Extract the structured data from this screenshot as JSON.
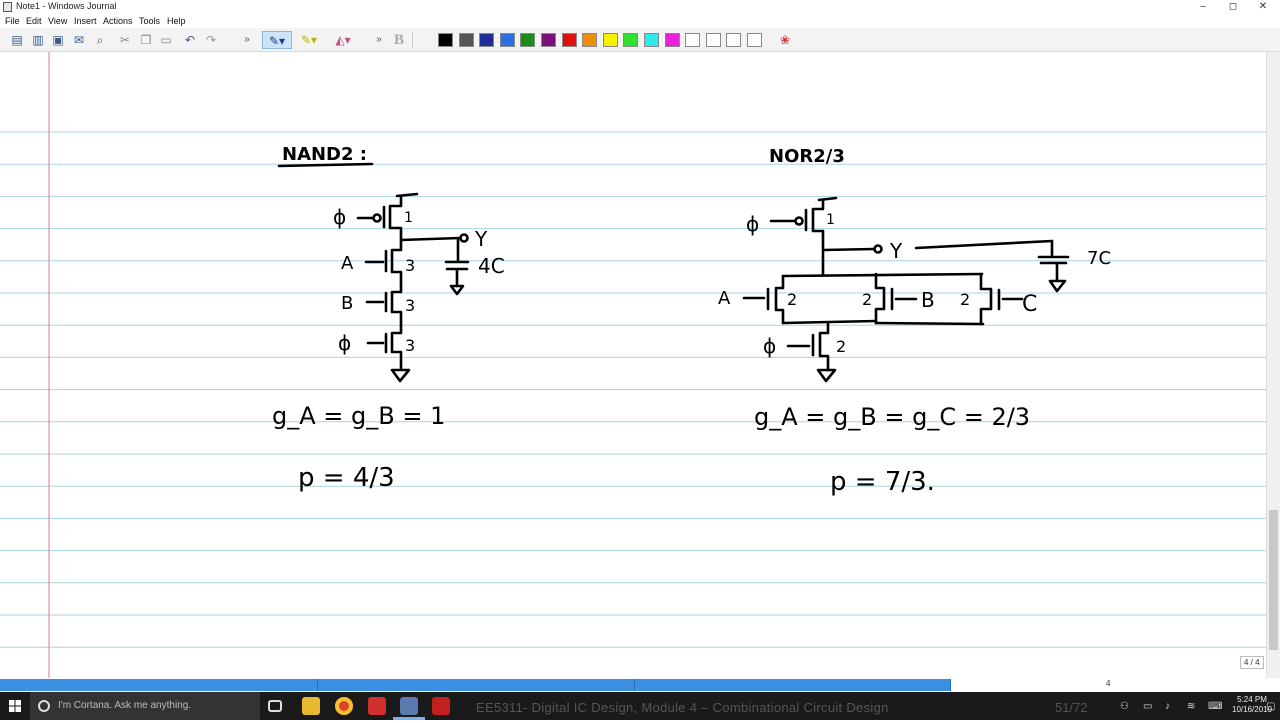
{
  "window": {
    "title": "Note1 - Windows Journal",
    "minimize": "–",
    "maximize": "◻",
    "close": "✕"
  },
  "menu": [
    "File",
    "Edit",
    "View",
    "Insert",
    "Actions",
    "Tools",
    "Help"
  ],
  "toolbar": {
    "bold_label": "B",
    "overflow": "»",
    "icons": [
      "new-note-icon",
      "open-icon",
      "save-icon",
      "email-icon",
      "find-icon",
      "cut-icon",
      "copy-icon",
      "paste-icon",
      "undo-icon",
      "redo-icon",
      "pen-icon",
      "highlighter-icon",
      "eraser-icon",
      "bold-icon",
      "color-wheel-icon"
    ],
    "colors": [
      "#000000",
      "#555555",
      "#1f2d9a",
      "#2b6ee0",
      "#1a8a1a",
      "#7a1080",
      "#e01010",
      "#f0900a",
      "#f5f000",
      "#30e030",
      "#30e8e8",
      "#e820d8",
      "#ffffff",
      "#ffffff",
      "#ffffff",
      "#ffffff"
    ]
  },
  "page": {
    "ruled_line_color": "#a8d4e6",
    "margin_line_color": "#e07a8a",
    "ink_color": "#000000"
  },
  "ink": {
    "left": {
      "title": "NAND2 :",
      "sizes": [
        "1",
        "3",
        "3",
        "3"
      ],
      "inputs": [
        "ϕ",
        "A",
        "B",
        "ϕ"
      ],
      "output": "Y",
      "load": "4C",
      "effort": "g_A = g_B = 1",
      "parasitic": "p = 4/3"
    },
    "right": {
      "title": "NOR2/3",
      "sizes": [
        "1",
        "2",
        "2",
        "2",
        "2"
      ],
      "inputs": [
        "ϕ",
        "A",
        "B",
        "C",
        "ϕ"
      ],
      "output": "Y",
      "load": "7C",
      "effort": "g_A = g_B = g_C = 2/3",
      "parasitic": "p = 7/3."
    }
  },
  "scroll": {
    "page_indicator": "4 / 4",
    "page_number": "4"
  },
  "taskbar": {
    "search_placeholder": "I'm Cortana. Ask me anything.",
    "video_title": "EE5311- Digital IC Design, Module 4 – Combinational Circuit Design",
    "video_count": "51/72",
    "time": "5:24 PM",
    "date": "10/16/2019",
    "icons": [
      "windows-start-icon",
      "task-view-icon",
      "file-explorer-icon",
      "chrome-icon",
      "app-red-icon",
      "windows-journal-icon",
      "pdf-icon"
    ]
  }
}
